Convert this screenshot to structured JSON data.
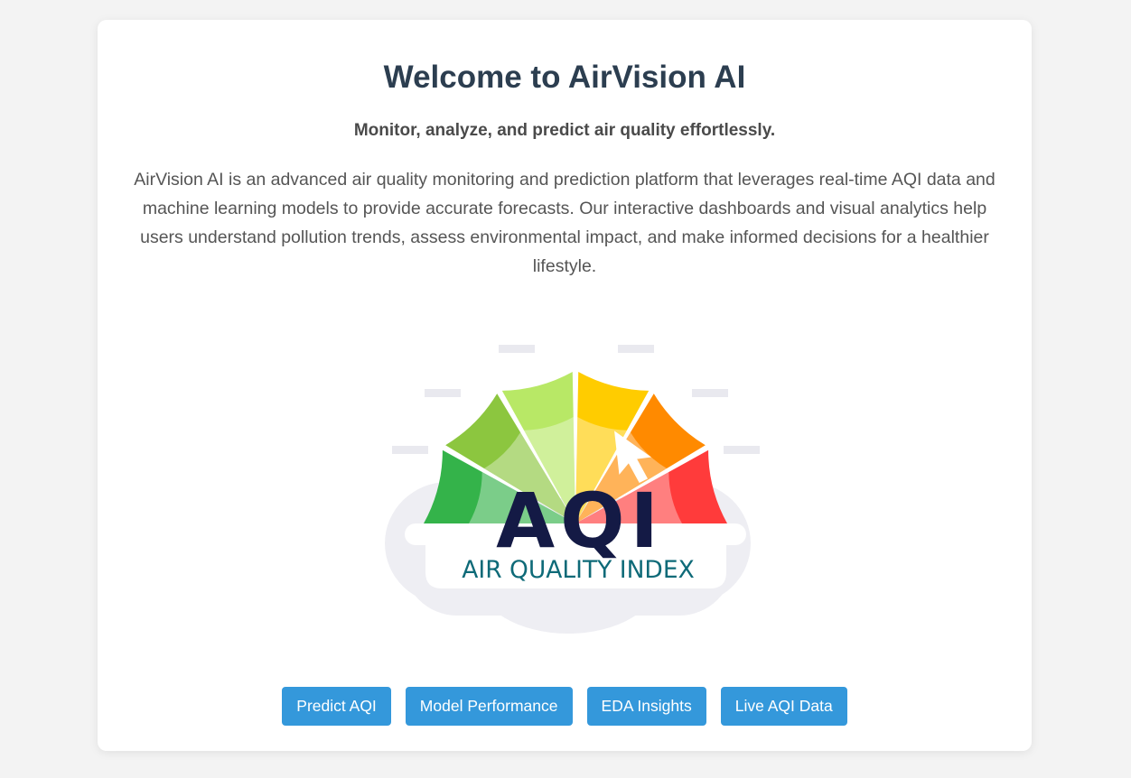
{
  "page": {
    "title": "Welcome to AirVision AI",
    "subtitle": "Monitor, analyze, and predict air quality effortlessly.",
    "description": "AirVision AI is an advanced air quality monitoring and prediction platform that leverages real-time AQI data and machine learning models to provide accurate forecasts. Our interactive dashboards and visual analytics help users understand pollution trends, assess environmental impact, and make informed decisions for a healthier lifestyle."
  },
  "logo": {
    "main_text": "AQI",
    "caption": "AIR QUALITY INDEX",
    "icon": "aqi-gauge-icon",
    "colors": {
      "main_text": "#141a45",
      "caption": "#0e6a78",
      "segments": [
        "#34b34a",
        "#8cc63f",
        "#b8e866",
        "#ffcc00",
        "#ff8a00",
        "#ff3b3b"
      ]
    }
  },
  "buttons": [
    {
      "label": "Predict AQI"
    },
    {
      "label": "Model Performance"
    },
    {
      "label": "EDA Insights"
    },
    {
      "label": "Live AQI Data"
    }
  ],
  "colors": {
    "background": "#f3f3f3",
    "card": "#ffffff",
    "title": "#2c3e50",
    "button": "#3498db"
  }
}
